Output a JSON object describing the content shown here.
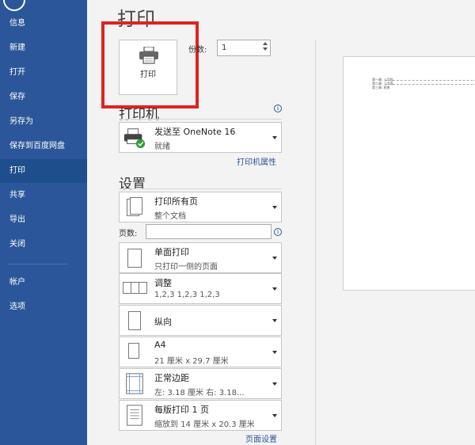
{
  "sidebar": {
    "items": [
      {
        "label": "信息"
      },
      {
        "label": "新建"
      },
      {
        "label": "打开"
      },
      {
        "label": "保存"
      },
      {
        "label": "另存为"
      },
      {
        "label": "保存到百度网盘"
      },
      {
        "label": "打印"
      },
      {
        "label": "共享"
      },
      {
        "label": "导出"
      },
      {
        "label": "关闭"
      },
      {
        "label": "帐户"
      },
      {
        "label": "选项"
      }
    ],
    "active_index": 6,
    "bg_color": "#2b579a"
  },
  "page_title": "打印",
  "print_button": {
    "label": "打印",
    "icon": "printer-icon"
  },
  "copies": {
    "label": "份数:",
    "value": "1"
  },
  "printer_section": {
    "heading": "打印机",
    "printer": {
      "name": "发送至 OneNote 16",
      "status": "就绪"
    },
    "properties_link": "打印机属性"
  },
  "settings_section": {
    "heading": "设置",
    "print_pages": {
      "main": "打印所有页",
      "sub": "整个文档"
    },
    "pages_label": "页数:",
    "pages_value": "",
    "sides": {
      "main": "单面打印",
      "sub": "只打印一侧的页面"
    },
    "collate": {
      "main": "调整",
      "sub": "1,2,3    1,2,3    1,2,3"
    },
    "orientation": {
      "main": "纵向"
    },
    "paper": {
      "main": "A4",
      "sub": "21 厘米 x 29.7 厘米"
    },
    "margins": {
      "main": "正常边距",
      "sub": "左: 3.18 厘米    右: 3.18..."
    },
    "per_sheet": {
      "main": "每版打印 1 页",
      "sub": "缩放到 14 厘米 x 20.3 厘米"
    },
    "page_setup_link": "页面设置"
  },
  "preview": {
    "lines": [
      "第一章: 三字段",
      "第二章: 三字段",
      "第三章: 结束"
    ]
  },
  "colors": {
    "accent": "#2b579a",
    "highlight": "#e3211f"
  }
}
